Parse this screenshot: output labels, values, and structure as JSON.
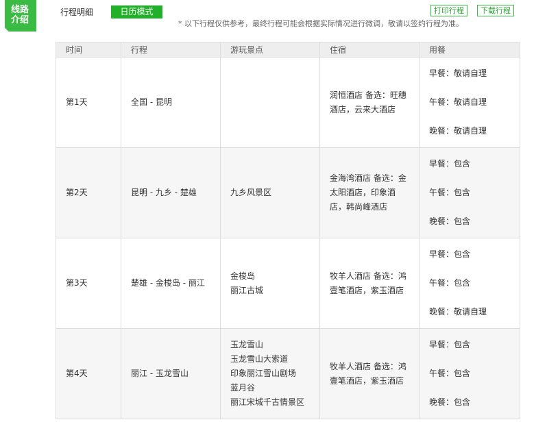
{
  "tag": {
    "line1": "线路",
    "line2": "介绍"
  },
  "tabs": {
    "detail": "行程明细",
    "calendar": "日历模式"
  },
  "actions": {
    "print": "打印行程",
    "download": "下载行程"
  },
  "note": "* 以下行程仅供参考，最终行程可能会根据实际情况进行微调，敬请以签约行程为准。",
  "table": {
    "headers": [
      "时间",
      "行程",
      "游玩景点",
      "住宿",
      "用餐"
    ],
    "rows": [
      {
        "day": "第1天",
        "route": "全国 - 昆明",
        "spots": [],
        "hotel": "润恒酒店 备选：旺穗酒店，云来大酒店",
        "meals": [
          "早餐：敬请自理",
          "午餐：敬请自理",
          "晚餐：敬请自理"
        ]
      },
      {
        "day": "第2天",
        "route": "昆明 - 九乡 - 楚雄",
        "spots": [
          "九乡风景区"
        ],
        "hotel": "金海湾酒店 备选：金太阳酒店，印象酒店，韩尚峰酒店",
        "meals": [
          "早餐：包含",
          "午餐：包含",
          "晚餐：包含"
        ]
      },
      {
        "day": "第3天",
        "route": "楚雄 - 金梭岛 - 丽江",
        "spots": [
          "金梭岛",
          "丽江古城"
        ],
        "hotel": "牧羊人酒店 备选：鸿壹笔酒店，紫玉酒店",
        "meals": [
          "早餐：包含",
          "午餐：包含",
          "晚餐：敬请自理"
        ]
      },
      {
        "day": "第4天",
        "route": "丽江 - 玉龙雪山",
        "spots": [
          "玉龙雪山",
          "玉龙雪山大索道",
          "印象丽江雪山剧场",
          "蓝月谷",
          "丽江宋城千古情景区"
        ],
        "hotel": "牧羊人酒店 备选：鸿壹笔酒店，紫玉酒店",
        "meals": [
          "早餐：包含",
          "午餐：包含",
          "晚餐：包含"
        ]
      }
    ]
  },
  "colors": {
    "accent": "#3cbb44",
    "button": "#22b02a",
    "header_bg": "#eeeeee",
    "alt_row": "#f6f6f6"
  }
}
